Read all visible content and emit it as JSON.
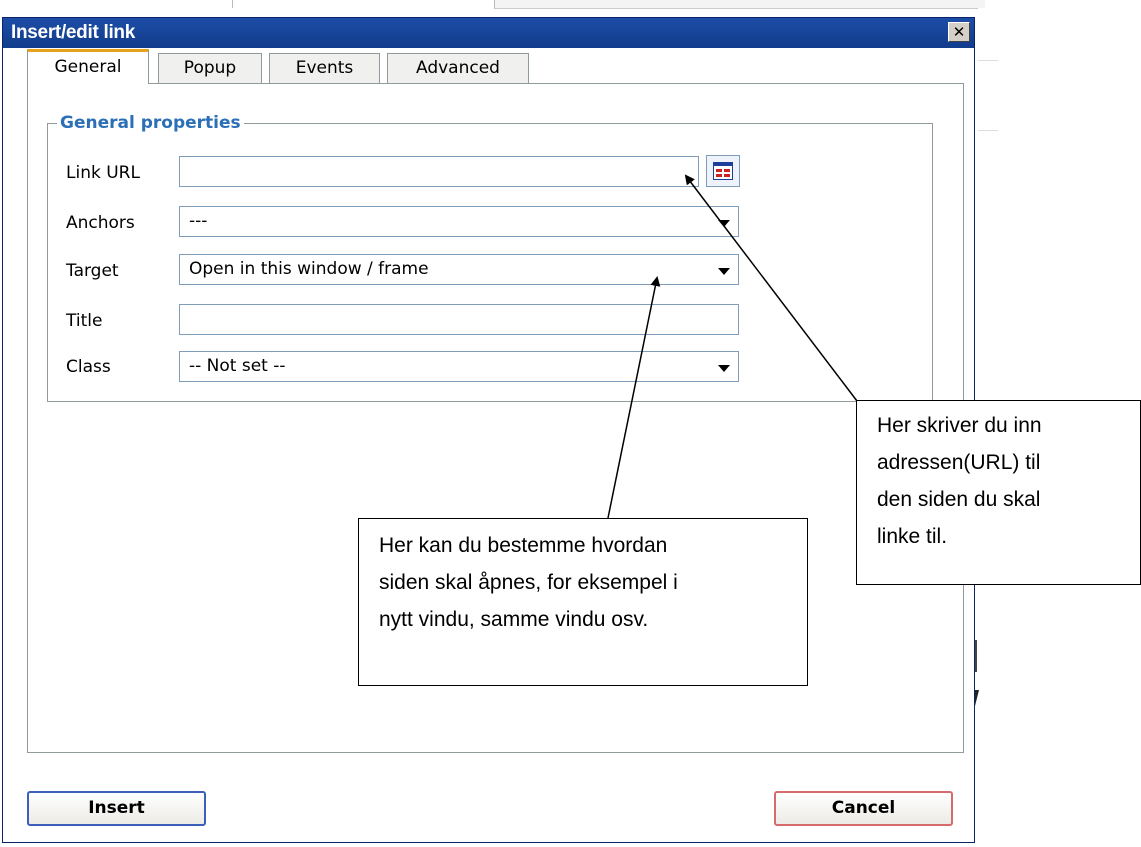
{
  "dialog": {
    "title": "Insert/edit link",
    "close_glyph": "✕"
  },
  "tabs": [
    {
      "label": "General",
      "active": true
    },
    {
      "label": "Popup",
      "active": false
    },
    {
      "label": "Events",
      "active": false
    },
    {
      "label": "Advanced",
      "active": false
    }
  ],
  "general": {
    "legend": "General properties",
    "link_url": {
      "label": "Link URL",
      "value": ""
    },
    "anchors": {
      "label": "Anchors",
      "value": "---"
    },
    "target": {
      "label": "Target",
      "value": "Open in this window / frame"
    },
    "title": {
      "label": "Title",
      "value": ""
    },
    "class": {
      "label": "Class",
      "value": "-- Not set --"
    }
  },
  "buttons": {
    "insert": "Insert",
    "cancel": "Cancel"
  },
  "callouts": {
    "url": "Her skriver du inn\nadressen(URL) til\nden siden du skal\nlinke til.",
    "target": "Her kan du bestemme hvordan\nsiden skal åpnes, for eksempel i\nnytt vindu, samme vindu osv."
  },
  "icons": {
    "browse": "browse-icon",
    "close": "close-icon",
    "dropdown": "chevron-down-icon"
  }
}
